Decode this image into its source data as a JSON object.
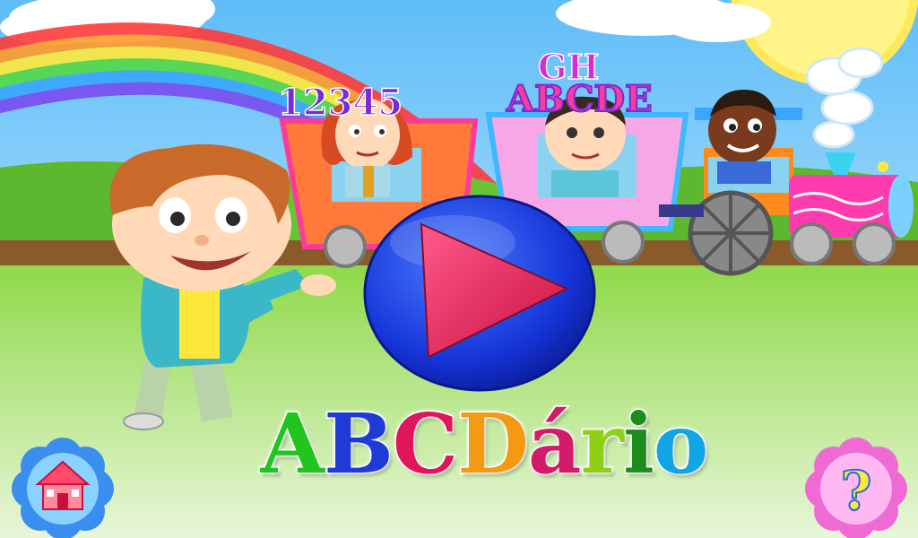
{
  "app": {
    "title_letters": [
      {
        "char": "A",
        "color": "#22c41e"
      },
      {
        "char": "B",
        "color": "#1f3bd6"
      },
      {
        "char": "C",
        "color": "#e0155a"
      },
      {
        "char": "D",
        "color": "#f39a12"
      },
      {
        "char": "á",
        "color": "#d41b6a"
      },
      {
        "char": "r",
        "color": "#8fcf16"
      },
      {
        "char": "i",
        "color": "#1e8c1a"
      },
      {
        "char": "o",
        "color": "#10a6e6"
      }
    ]
  },
  "train": {
    "car1_numbers": "12345",
    "car2_letters": "ABCDE",
    "car2_letters_top": "GH"
  },
  "controls": {
    "play_button": "play",
    "home_button": "home",
    "help_label": "?"
  },
  "colors": {
    "sky_top": "#6ec6ff",
    "sky_bottom": "#d9f2ff",
    "grass": "#77c93a",
    "play_blue": "#1635d8",
    "play_triangle": "#f0245e",
    "home_flower": "#3a8ef0",
    "help_flower": "#f06ad6"
  }
}
